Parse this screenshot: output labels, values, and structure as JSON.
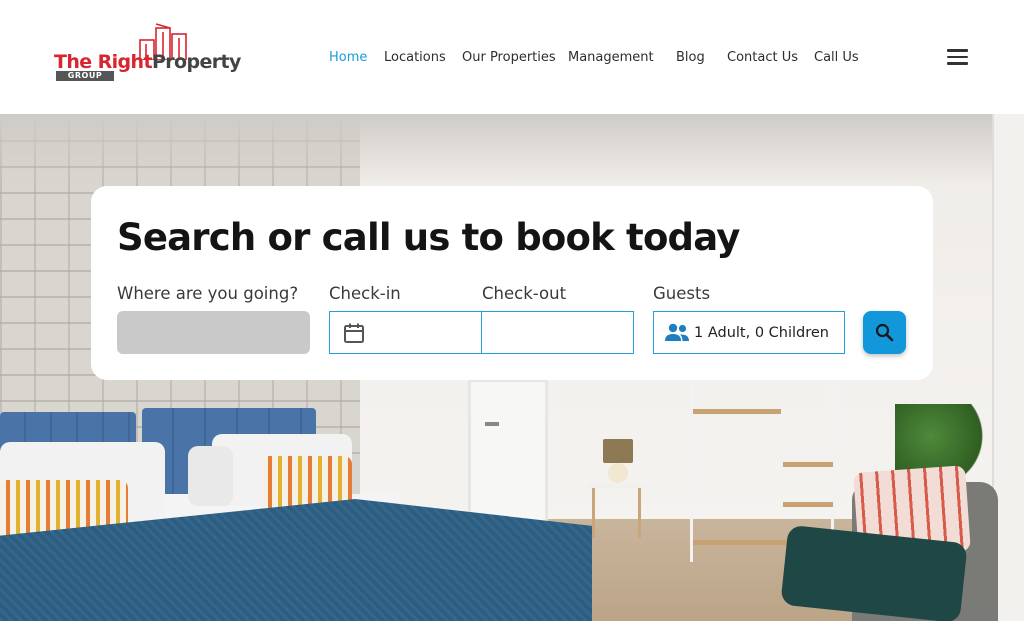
{
  "header": {
    "logo": {
      "text_part1": "The Right",
      "text_part2": "Property",
      "sub": "GROUP"
    },
    "nav": [
      {
        "label": "Home",
        "active": true
      },
      {
        "label": "Locations",
        "active": false
      },
      {
        "label": "Our Properties",
        "active": false
      },
      {
        "label": "Management",
        "active": false
      },
      {
        "label": "Blog",
        "active": false
      },
      {
        "label": "Contact Us",
        "active": false
      },
      {
        "label": "Call Us",
        "active": false
      }
    ],
    "menu_icon": "hamburger-menu-icon"
  },
  "search": {
    "title": "Search or call us to book today",
    "destination_label": "Where are you going?",
    "destination_value": "",
    "checkin_label": "Check-in",
    "checkin_value": "",
    "checkout_label": "Check-out",
    "checkout_value": "",
    "guests_label": "Guests",
    "guests_value": "1 Adult, 0 Children",
    "search_icon": "search-icon"
  },
  "colors": {
    "accent": "#1a9cd8",
    "button": "#1297db",
    "field_border": "#21a0da",
    "logo_red": "#d8252f",
    "logo_gray": "#444444",
    "destination_fill": "#c9c9c9"
  }
}
